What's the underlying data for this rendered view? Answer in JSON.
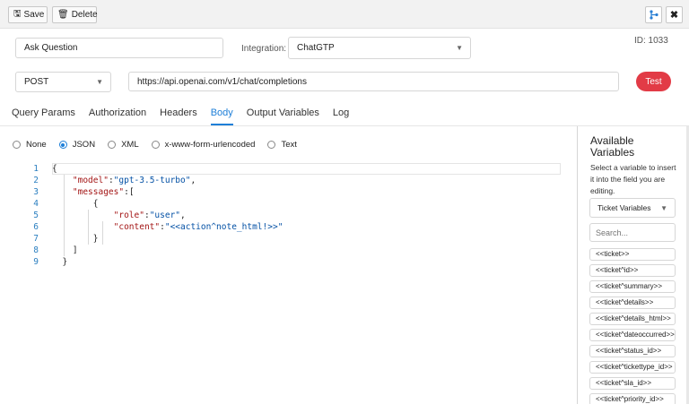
{
  "toolbar": {
    "save_label": "Save",
    "delete_label": "Delete"
  },
  "form": {
    "name_value": "Ask Question",
    "integration_label": "Integration:",
    "integration_value": "ChatGTP",
    "id_label": "ID: 1033",
    "method_value": "POST",
    "url_value": "https://api.openai.com/v1/chat/completions",
    "test_label": "Test"
  },
  "tabs": [
    "Query Params",
    "Authorization",
    "Headers",
    "Body",
    "Output Variables",
    "Log"
  ],
  "active_tab": "Body",
  "body_types": [
    {
      "label": "None",
      "selected": false
    },
    {
      "label": "JSON",
      "selected": true
    },
    {
      "label": "XML",
      "selected": false
    },
    {
      "label": "x-www-form-urlencoded",
      "selected": false
    },
    {
      "label": "Text",
      "selected": false
    }
  ],
  "editor": {
    "line_numbers": [
      "1",
      "2",
      "3",
      "4",
      "5",
      "6",
      "7",
      "8",
      "9"
    ],
    "lines": [
      {
        "indent": "",
        "parts": [
          [
            "p",
            "{"
          ]
        ]
      },
      {
        "indent": "    ",
        "parts": [
          [
            "k",
            "\"model\""
          ],
          [
            "p",
            ":"
          ],
          [
            "s",
            "\"gpt-3.5-turbo\""
          ],
          [
            "p",
            ","
          ]
        ]
      },
      {
        "indent": "    ",
        "parts": [
          [
            "k",
            "\"messages\""
          ],
          [
            "p",
            ":["
          ]
        ]
      },
      {
        "indent": "        ",
        "parts": [
          [
            "p",
            "{"
          ]
        ]
      },
      {
        "indent": "            ",
        "parts": [
          [
            "k",
            "\"role\""
          ],
          [
            "p",
            ":"
          ],
          [
            "s",
            "\"user\""
          ],
          [
            "p",
            ","
          ]
        ]
      },
      {
        "indent": "            ",
        "parts": [
          [
            "k",
            "\"content\""
          ],
          [
            "p",
            ":"
          ],
          [
            "s",
            "\"<<action^note_html!>>\""
          ]
        ]
      },
      {
        "indent": "        ",
        "parts": [
          [
            "p",
            "}"
          ]
        ]
      },
      {
        "indent": "    ",
        "parts": [
          [
            "p",
            "]"
          ]
        ]
      },
      {
        "indent": "  ",
        "parts": [
          [
            "p",
            "}"
          ]
        ]
      }
    ]
  },
  "side_panel": {
    "title": "Available Variables",
    "description": "Select a variable to insert it into the field you are editing.",
    "select_value": "Ticket Variables",
    "search_placeholder": "Search...",
    "variables": [
      "<<ticket>>",
      "<<ticket^id>>",
      "<<ticket^summary>>",
      "<<ticket^details>>",
      "<<ticket^details_html>>",
      "<<ticket^dateoccurred>>",
      "<<ticket^status_id>>",
      "<<ticket^tickettype_id>>",
      "<<ticket^sla_id>>",
      "<<ticket^priority_id>>"
    ]
  },
  "colors": {
    "accent": "#1e7fd8",
    "test_button": "#e23b46"
  }
}
